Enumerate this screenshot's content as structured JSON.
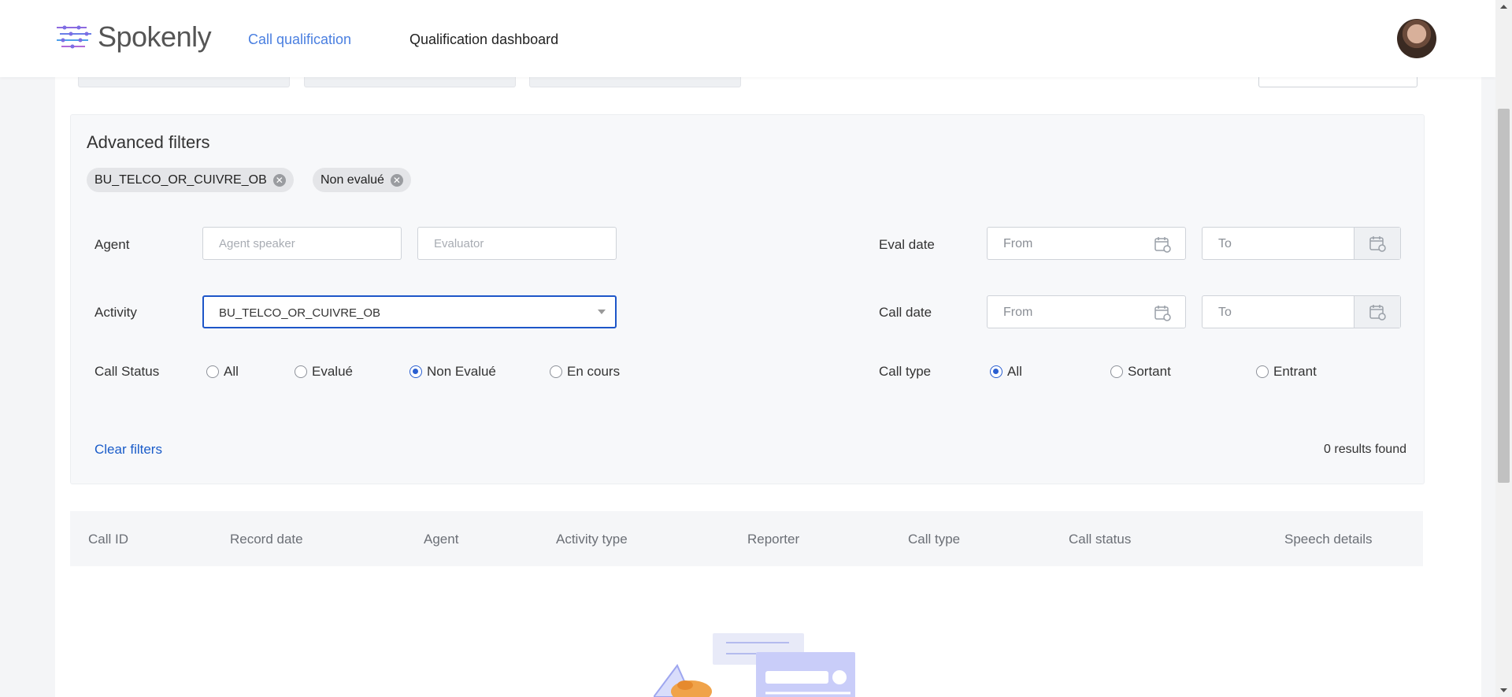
{
  "header": {
    "logo_text": "Spokenly",
    "nav": [
      {
        "label": "Call qualification",
        "active": true
      },
      {
        "label": "Qualification dashboard",
        "active": false
      }
    ]
  },
  "filters": {
    "title": "Advanced filters",
    "chips": [
      "BU_TELCO_OR_CUIVRE_OB",
      "Non evalué"
    ],
    "agent": {
      "label": "Agent",
      "agent_placeholder": "Agent speaker",
      "evaluator_placeholder": "Evaluator"
    },
    "activity": {
      "label": "Activity",
      "selected": "BU_TELCO_OR_CUIVRE_OB"
    },
    "call_status": {
      "label": "Call Status",
      "options": [
        "All",
        "Evalué",
        "Non Evalué",
        "En cours"
      ],
      "selected": "Non Evalué"
    },
    "eval_date": {
      "label": "Eval date",
      "from_placeholder": "From",
      "to_placeholder": "To"
    },
    "call_date": {
      "label": "Call date",
      "from_placeholder": "From",
      "to_placeholder": "To"
    },
    "call_type": {
      "label": "Call type",
      "options": [
        "All",
        "Sortant",
        "Entrant"
      ],
      "selected": "All"
    },
    "clear_label": "Clear filters",
    "results_text": "0 results found"
  },
  "table": {
    "columns": [
      "Call ID",
      "Record date",
      "Agent",
      "Activity type",
      "Reporter",
      "Call type",
      "Call status",
      "Speech details"
    ]
  },
  "colors": {
    "accent": "#2a5fd1",
    "link": "#1a5cc9",
    "nav_active": "#4a7fe0"
  }
}
